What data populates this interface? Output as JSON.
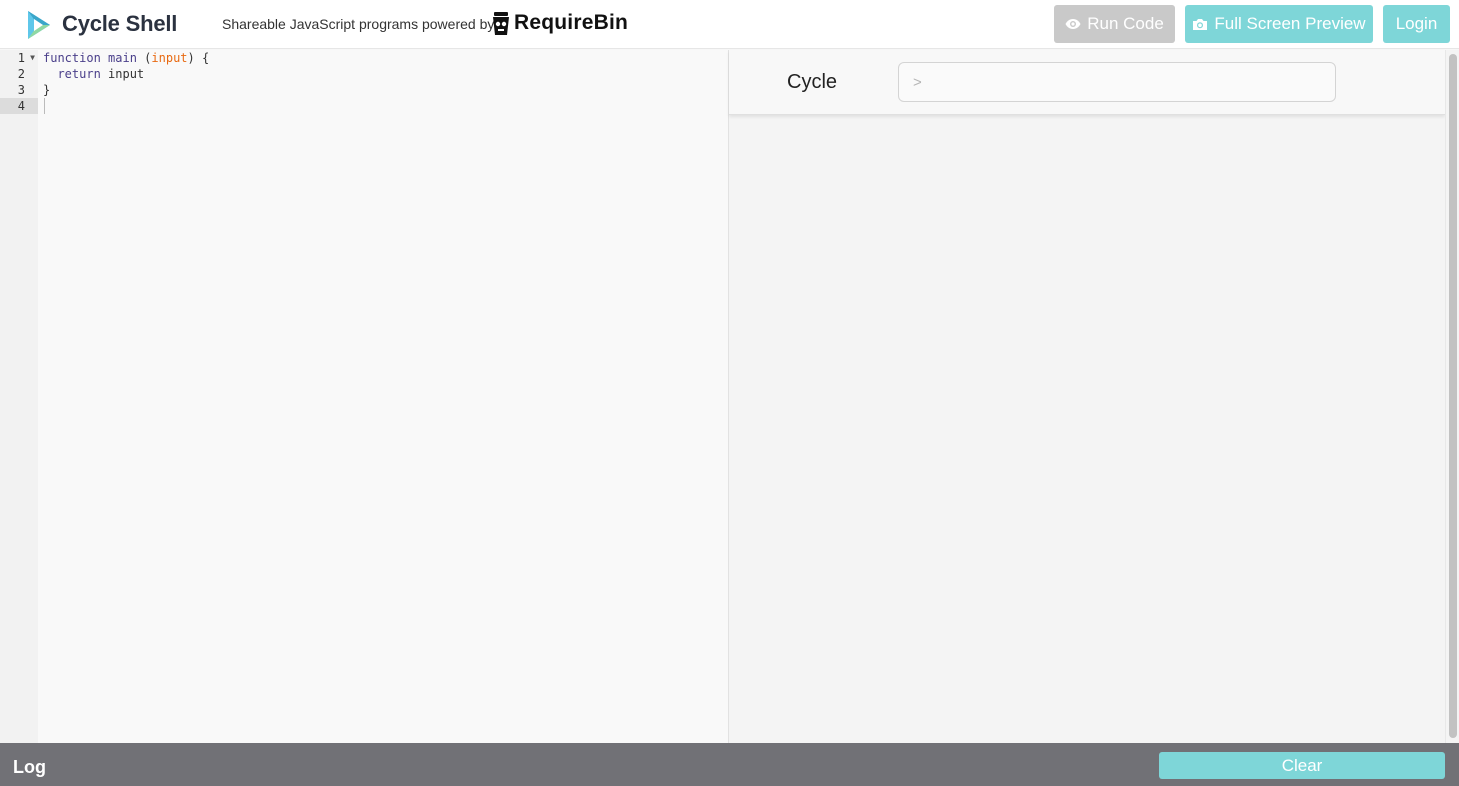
{
  "header": {
    "app_title": "Cycle Shell",
    "tagline": "Shareable JavaScript programs powered by",
    "powered_by": "RequireBin",
    "buttons": {
      "run_code": "Run Code",
      "full_screen_preview": "Full Screen Preview",
      "login": "Login"
    },
    "icons": {
      "logo": "cycle-logo-icon",
      "powered_by_logo": "requirebin-logo-icon",
      "run_code": "eye-icon",
      "full_screen_preview": "camera-icon"
    }
  },
  "editor": {
    "line_numbers": [
      "1",
      "2",
      "3",
      "4"
    ],
    "active_line": "4",
    "lines": [
      {
        "kw": "function",
        "fn": "main",
        "open": " (",
        "param": "input",
        "close": ") {"
      },
      {
        "text": "  return input"
      },
      {
        "text": "}"
      },
      {
        "text": ""
      }
    ],
    "fold_icon": "fold-arrow-icon"
  },
  "preview": {
    "title": "Cycle",
    "input_placeholder": ">",
    "input_value": ""
  },
  "log": {
    "label": "Log",
    "clear_button": "Clear"
  },
  "colors": {
    "accent": "#7ed6d8",
    "disabled": "#c9c9c9",
    "log_bar": "#717176",
    "title": "#2b3240"
  }
}
